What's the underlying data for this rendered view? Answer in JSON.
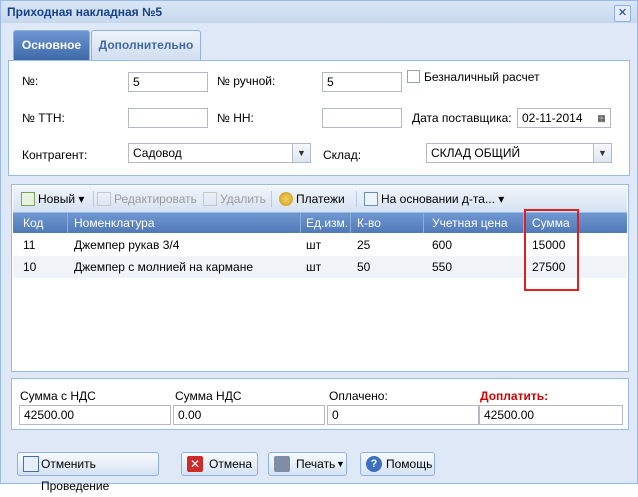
{
  "window": {
    "title": "Приходная накладная №5"
  },
  "tabs": [
    {
      "label": "Основное"
    },
    {
      "label": "Дополнительно"
    }
  ],
  "form": {
    "num_label": "№:",
    "num_value": "5",
    "manual_label": "№ ручной:",
    "manual_value": "5",
    "cashless_label": "Безналичный расчет",
    "ttn_label": "№ ТТН:",
    "ttn_value": "",
    "nn_label": "№ НН:",
    "nn_value": "",
    "supplier_date_label": "Дата поставщика:",
    "supplier_date_value": "02-11-2014",
    "contractor_label": "Контрагент:",
    "contractor_value": "Садовод",
    "warehouse_label": "Склад:",
    "warehouse_value": "СКЛАД ОБЩИЙ"
  },
  "toolbar": {
    "new_label": "Новый",
    "edit_label": "Редактировать",
    "delete_label": "Удалить",
    "payments_label": "Платежи",
    "based_on_label": "На основании д-та..."
  },
  "grid": {
    "columns": [
      "Код",
      "Номенклатура",
      "Ед.изм.",
      "К-во",
      "Учетная цена",
      "Сумма"
    ],
    "rows": [
      {
        "code": "11",
        "name": "Джемпер рукав 3/4",
        "unit": "шт",
        "qty": "25",
        "price": "600",
        "sum": "15000"
      },
      {
        "code": "10",
        "name": "Джемпер с молнией на кармане",
        "unit": "шт",
        "qty": "50",
        "price": "550",
        "sum": "27500"
      }
    ]
  },
  "totals": {
    "sum_vat_label": "Сумма с НДС",
    "sum_vat_value": "42500.00",
    "vat_label": "Сумма НДС",
    "vat_value": "0.00",
    "paid_label": "Оплачено:",
    "paid_value": "0",
    "topay_label": "Доплатить:",
    "topay_value": "42500.00"
  },
  "buttons": {
    "unpost_label": "Отменить Проведение",
    "cancel_label": "Отмена",
    "print_label": "Печать",
    "help_label": "Помощь"
  },
  "colors": {
    "accent": "#15428b",
    "highlight": "#e02020",
    "topay": "#d00000"
  }
}
